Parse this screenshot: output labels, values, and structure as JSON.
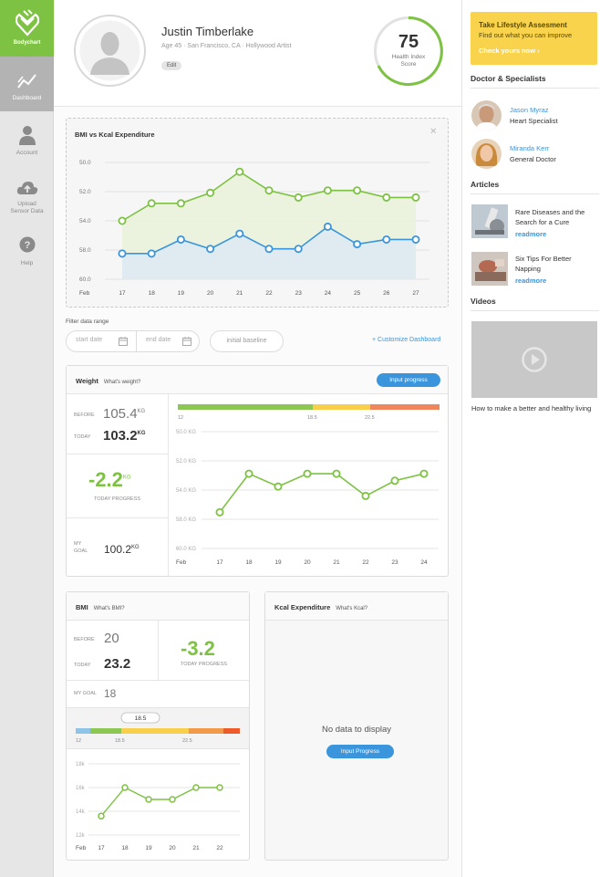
{
  "app": {
    "logo_label": "Bodychart"
  },
  "nav": [
    {
      "label": "Dashboard",
      "icon": "trend-icon"
    },
    {
      "label": "Account",
      "icon": "user-icon"
    },
    {
      "label": "Upload\nSensor Data",
      "label1": "Upload",
      "label2": "Sensor Data",
      "icon": "cloud-upload-icon"
    },
    {
      "label": "Help",
      "icon": "help-icon"
    }
  ],
  "profile": {
    "name": "Justin Timberlake",
    "meta": "Age 45 · San Francisco, CA · Hollywood Artist",
    "edit_label": "Edit",
    "score": "75",
    "score_label1": "Health Index",
    "score_label2": "Score"
  },
  "bmi_kcal_chart": {
    "title": "BMI vs Kcal Expenditure",
    "y_ticks": [
      "50.0",
      "52.0",
      "54.0",
      "58.0",
      "60.0"
    ],
    "x_ticks": [
      "Feb",
      "17",
      "18",
      "19",
      "20",
      "21",
      "22",
      "23",
      "24",
      "25",
      "26",
      "27"
    ]
  },
  "filter": {
    "label": "Filter data range",
    "start_placeholder": "start date",
    "end_placeholder": "end date",
    "baseline_label": "initial baseline",
    "customize_label": "+ Customize Dashboard"
  },
  "weight": {
    "title": "Weight",
    "sub": "What's weight?",
    "button": "Input progress",
    "before_label": "BEFORE",
    "before_value": "105.4",
    "today_label": "TODAY",
    "today_value": "103.2",
    "unit": "KG",
    "progress_value": "-2.2",
    "progress_label": "TODAY PROGRESS",
    "goal_label1": "MY",
    "goal_label2": "GOAL",
    "goal_value": "100.2",
    "scale_ticks": [
      "12",
      "18.5",
      "22.5"
    ],
    "y_ticks": [
      "50.0 KG",
      "52.0 KG",
      "54.0 KG",
      "58.0 KG",
      "60.0 KG"
    ],
    "x_ticks": [
      "Feb",
      "17",
      "18",
      "19",
      "20",
      "21",
      "22",
      "23",
      "24"
    ]
  },
  "bmi": {
    "title": "BMI",
    "sub": "What's BMI?",
    "before_label": "BEFORE",
    "before_value": "20",
    "today_label": "TODAY",
    "today_value": "23.2",
    "progress_value": "-3.2",
    "progress_label": "TODAY PROGRESS",
    "goal_label": "MY GOAL",
    "goal_value": "18",
    "marker": "18.5",
    "scale_ticks": [
      "12",
      "18.5",
      "22.5"
    ],
    "y_ticks": [
      "18k",
      "16k",
      "14k",
      "12k"
    ],
    "x_ticks": [
      "Feb",
      "17",
      "18",
      "19",
      "20",
      "21",
      "22"
    ]
  },
  "kcal": {
    "title": "Kcal Expenditure",
    "sub": "What's Kcal?",
    "empty_text": "No data to display",
    "button": "Input Progress"
  },
  "right": {
    "promo_title": "Take Lifestyle Assesment",
    "promo_text": "Find out what you can improve",
    "promo_link": "Check yours now",
    "doctors_title": "Doctor & Specialists",
    "doctors": [
      {
        "name": "Jason Myraz",
        "role": "Heart Specialist"
      },
      {
        "name": "Miranda Kerr",
        "role": "General Doctor"
      }
    ],
    "articles_title": "Articles",
    "articles": [
      {
        "title": "Rare Diseases and the Search for a Cure",
        "more": "readmore"
      },
      {
        "title": "Six Tips For Better Napping",
        "more": "readmore"
      }
    ],
    "videos_title": "Videos",
    "video_caption": "How to make a better and healthy living"
  },
  "colors": {
    "green": "#7dc242",
    "blue": "#3a95dc",
    "yellow": "#f9d34c",
    "orange": "#f08a4b"
  },
  "chart_data": [
    {
      "type": "line",
      "x": [
        "17",
        "18",
        "19",
        "20",
        "21",
        "22",
        "23",
        "24",
        "25",
        "26",
        "27"
      ],
      "series": [
        {
          "values": [
            55.0,
            53.5,
            53.5,
            52.6,
            50.8,
            52.4,
            53.0,
            52.4,
            52.4,
            53.0,
            53.0
          ]
        },
        {
          "values": [
            57.8,
            57.8,
            56.6,
            57.4,
            56.1,
            57.4,
            57.4,
            55.5,
            57.0,
            56.6,
            56.6
          ]
        }
      ],
      "ylim": [
        50,
        60
      ]
    },
    {
      "type": "line",
      "x": [
        "17",
        "18",
        "19",
        "20",
        "21",
        "22",
        "23",
        "24"
      ],
      "series": [
        {
          "values": [
            56.9,
            53.6,
            54.7,
            53.6,
            53.6,
            55.5,
            54.2,
            53.6
          ]
        }
      ],
      "ylim": [
        50,
        60
      ]
    },
    {
      "type": "line",
      "x": [
        "17",
        "18",
        "19",
        "20",
        "21",
        "22"
      ],
      "series": [
        {
          "values": [
            13.6,
            16.0,
            15.0,
            15.0,
            16.0,
            16.0
          ]
        }
      ],
      "ylim": [
        12,
        18
      ]
    }
  ]
}
